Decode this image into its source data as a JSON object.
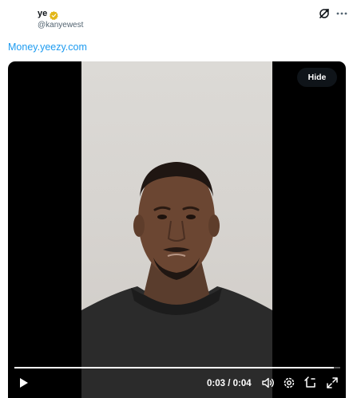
{
  "post": {
    "display_name": "ye",
    "handle": "@kanyewest",
    "link_text": "Money.yeezy.com"
  },
  "media": {
    "hide_label": "Hide",
    "current_time": "0:03",
    "duration": "0:04",
    "time_separator": "/",
    "progress": 0.98
  },
  "colors": {
    "link": "#1d9bf0",
    "verified_badge": "#e2b719",
    "hide_button_bg": "#0f1419"
  },
  "icons": [
    "verified-badge-icon",
    "grok-icon",
    "more-icon",
    "play-icon",
    "volume-icon",
    "settings-icon",
    "picture-in-picture-icon",
    "fullscreen-icon"
  ]
}
